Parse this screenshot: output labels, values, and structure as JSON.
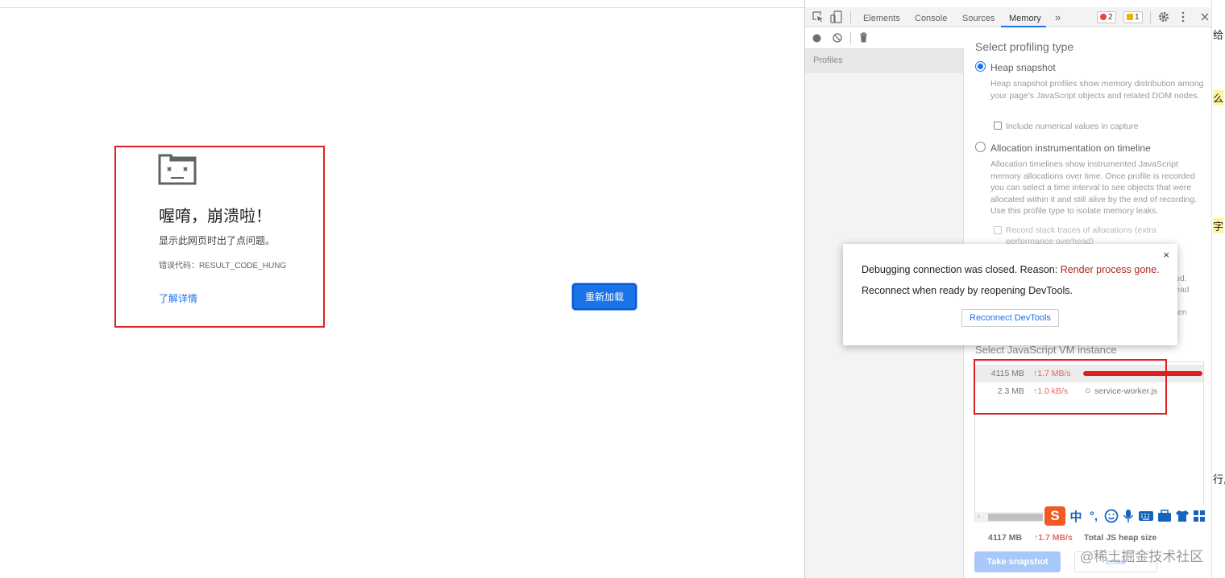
{
  "crash_page": {
    "title": "喔唷，崩溃啦！",
    "description": "显示此网页时出了点问题。",
    "error_code": "错误代码：RESULT_CODE_HUNG",
    "learn_more": "了解详情",
    "reload_button": "重新加载"
  },
  "devtools": {
    "tabs": [
      "Elements",
      "Console",
      "Sources",
      "Memory"
    ],
    "more_tabs": "»",
    "error_count": "2",
    "warning_count": "1",
    "sidebar": {
      "profiles_label": "Profiles"
    },
    "memory": {
      "select_profiling_type": "Select profiling type",
      "heap_snapshot_label": "Heap snapshot",
      "heap_snapshot_desc": "Heap snapshot profiles show memory distribution among your page's JavaScript objects and related DOM nodes.",
      "include_numerical": "Include numerical values in capture",
      "allocation_label": "Allocation instrumentation on timeline",
      "allocation_desc": "Allocation timelines show instrumented JavaScript memory allocations over time. Once profile is recorded you can select a time interval to see objects that were allocated within it and still alive by the end of recording. Use this profile type to isolate memory leaks.",
      "record_stack": "Record stack traces of allocations (extra performance overhead)",
      "partial_1": "od.",
      "partial_2": "ead",
      "partial_3": "en",
      "select_vm": "Select JavaScript VM instance",
      "vm_instances": [
        {
          "mb": "4115 MB",
          "rate": "↑1.7 MB/s",
          "name": "",
          "selected": true
        },
        {
          "mb": "2.3 MB",
          "rate": "↑1.0 kB/s",
          "name": "service-worker.js",
          "selected": false
        }
      ],
      "total_mb": "4117 MB",
      "total_rate": "↑1.7 MB/s",
      "total_label": "Total JS heap size",
      "take_snapshot": "Take snapshot",
      "load": "Load"
    }
  },
  "dialog": {
    "line1_prefix": "Debugging connection was closed. Reason: ",
    "line1_reason": "Render process gone.",
    "line2": "Reconnect when ready by reopening DevTools.",
    "reconnect_button": "Reconnect DevTools",
    "close": "×"
  },
  "right_strip": [
    "给",
    "么",
    "字",
    "行,"
  ],
  "ime": {
    "logo": "S",
    "chinese": "中",
    "punct": "°,"
  },
  "watermark": "@稀土掘金技术社区",
  "colors": {
    "accent": "#1a73e8",
    "annotation_red": "#e02020",
    "error_red": "#b0281e"
  }
}
